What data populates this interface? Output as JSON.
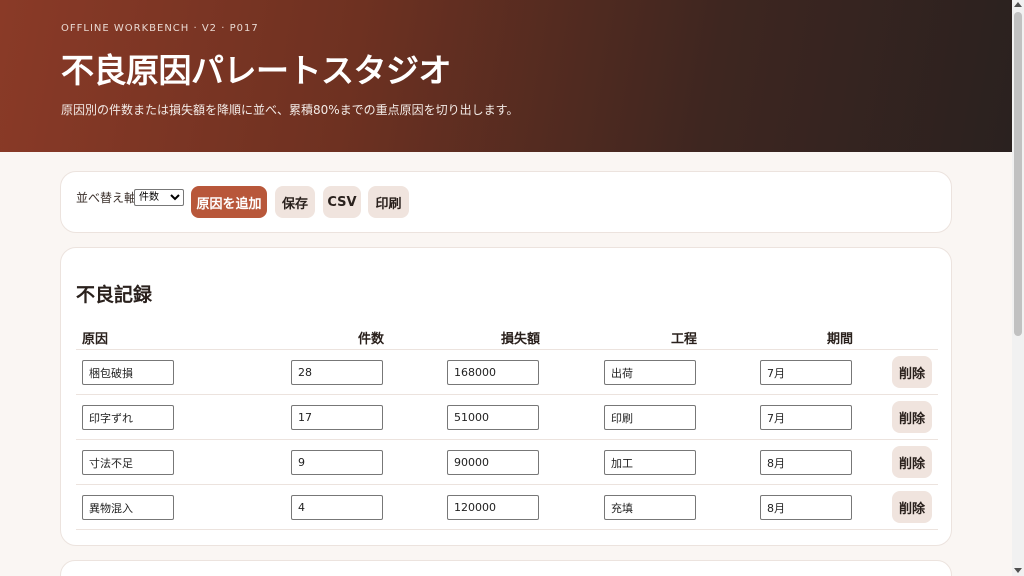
{
  "hero": {
    "eyebrow": "OFFLINE WORKBENCH · V2 · P017",
    "title": "不良原因パレートスタジオ",
    "subtitle": "原因別の件数または損失額を降順に並べ、累積80%までの重点原因を切り出します。"
  },
  "toolbar": {
    "sort_label": "並べ替え軸",
    "sort_value": "件数",
    "add_label": "原因を追加",
    "save_label": "保存",
    "csv_label": "CSV",
    "print_label": "印刷"
  },
  "records": {
    "title": "不良記録",
    "headers": [
      "原因",
      "件数",
      "損失額",
      "工程",
      "期間"
    ],
    "delete_label": "削除",
    "rows": [
      {
        "cause": "梱包破損",
        "count": "28",
        "loss": "168000",
        "process": "出荷",
        "period": "7月"
      },
      {
        "cause": "印字ずれ",
        "count": "17",
        "loss": "51000",
        "process": "印刷",
        "period": "7月"
      },
      {
        "cause": "寸法不足",
        "count": "9",
        "loss": "90000",
        "process": "加工",
        "period": "8月"
      },
      {
        "cause": "異物混入",
        "count": "4",
        "loss": "120000",
        "process": "充填",
        "period": "8月"
      }
    ]
  },
  "colors": {
    "accent": "#b8573a",
    "hero_start": "#8a3a27",
    "hero_end": "#2a211f"
  }
}
